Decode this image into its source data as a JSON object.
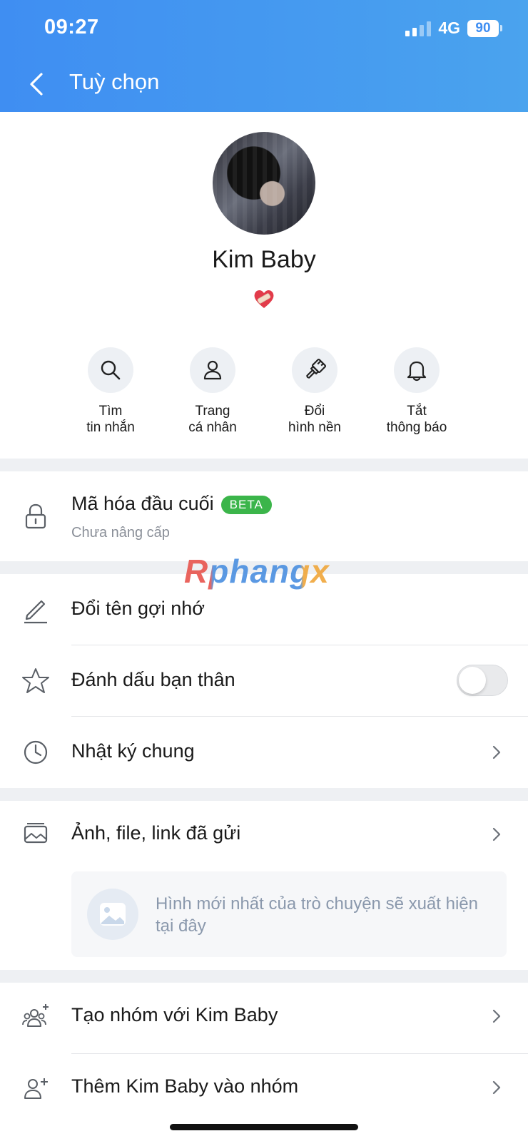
{
  "status_bar": {
    "time": "09:27",
    "network": "4G",
    "battery": "90"
  },
  "header": {
    "title": "Tuỳ chọn"
  },
  "profile": {
    "name": "Kim Baby",
    "status_emoji": "❤️‍🩹"
  },
  "actions": [
    {
      "line1": "Tìm",
      "line2": "tin nhắn",
      "icon": "search-icon"
    },
    {
      "line1": "Trang",
      "line2": "cá nhân",
      "icon": "person-icon"
    },
    {
      "line1": "Đổi",
      "line2": "hình nền",
      "icon": "paint-brush-icon"
    },
    {
      "line1": "Tắt",
      "line2": "thông báo",
      "icon": "bell-icon"
    }
  ],
  "encryption": {
    "title": "Mã hóa đầu cuối",
    "badge": "BETA",
    "subtitle": "Chưa nâng cấp",
    "icon": "lock-icon"
  },
  "menu": {
    "rename": {
      "label": "Đổi tên gợi nhớ",
      "icon": "pencil-icon"
    },
    "best_friend": {
      "label": "Đánh dấu bạn thân",
      "icon": "star-icon",
      "toggle_on": false
    },
    "shared_diary": {
      "label": "Nhật ký chung",
      "icon": "clock-icon"
    },
    "media": {
      "label": "Ảnh, file, link đã gửi",
      "icon": "gallery-icon",
      "placeholder": "Hình mới nhất của trò chuyện sẽ xuất hiện tại đây"
    },
    "create_group": {
      "label": "Tạo nhóm với Kim Baby",
      "icon": "group-add-icon"
    },
    "add_to_group": {
      "label": "Thêm Kim Baby vào nhóm",
      "icon": "person-add-icon"
    }
  },
  "watermark": {
    "text": "Rphangx"
  },
  "colors": {
    "header_start": "#3f8ef2",
    "header_end": "#4aa3ee",
    "beta_green": "#3bb54a",
    "separator": "#eef0f3"
  }
}
